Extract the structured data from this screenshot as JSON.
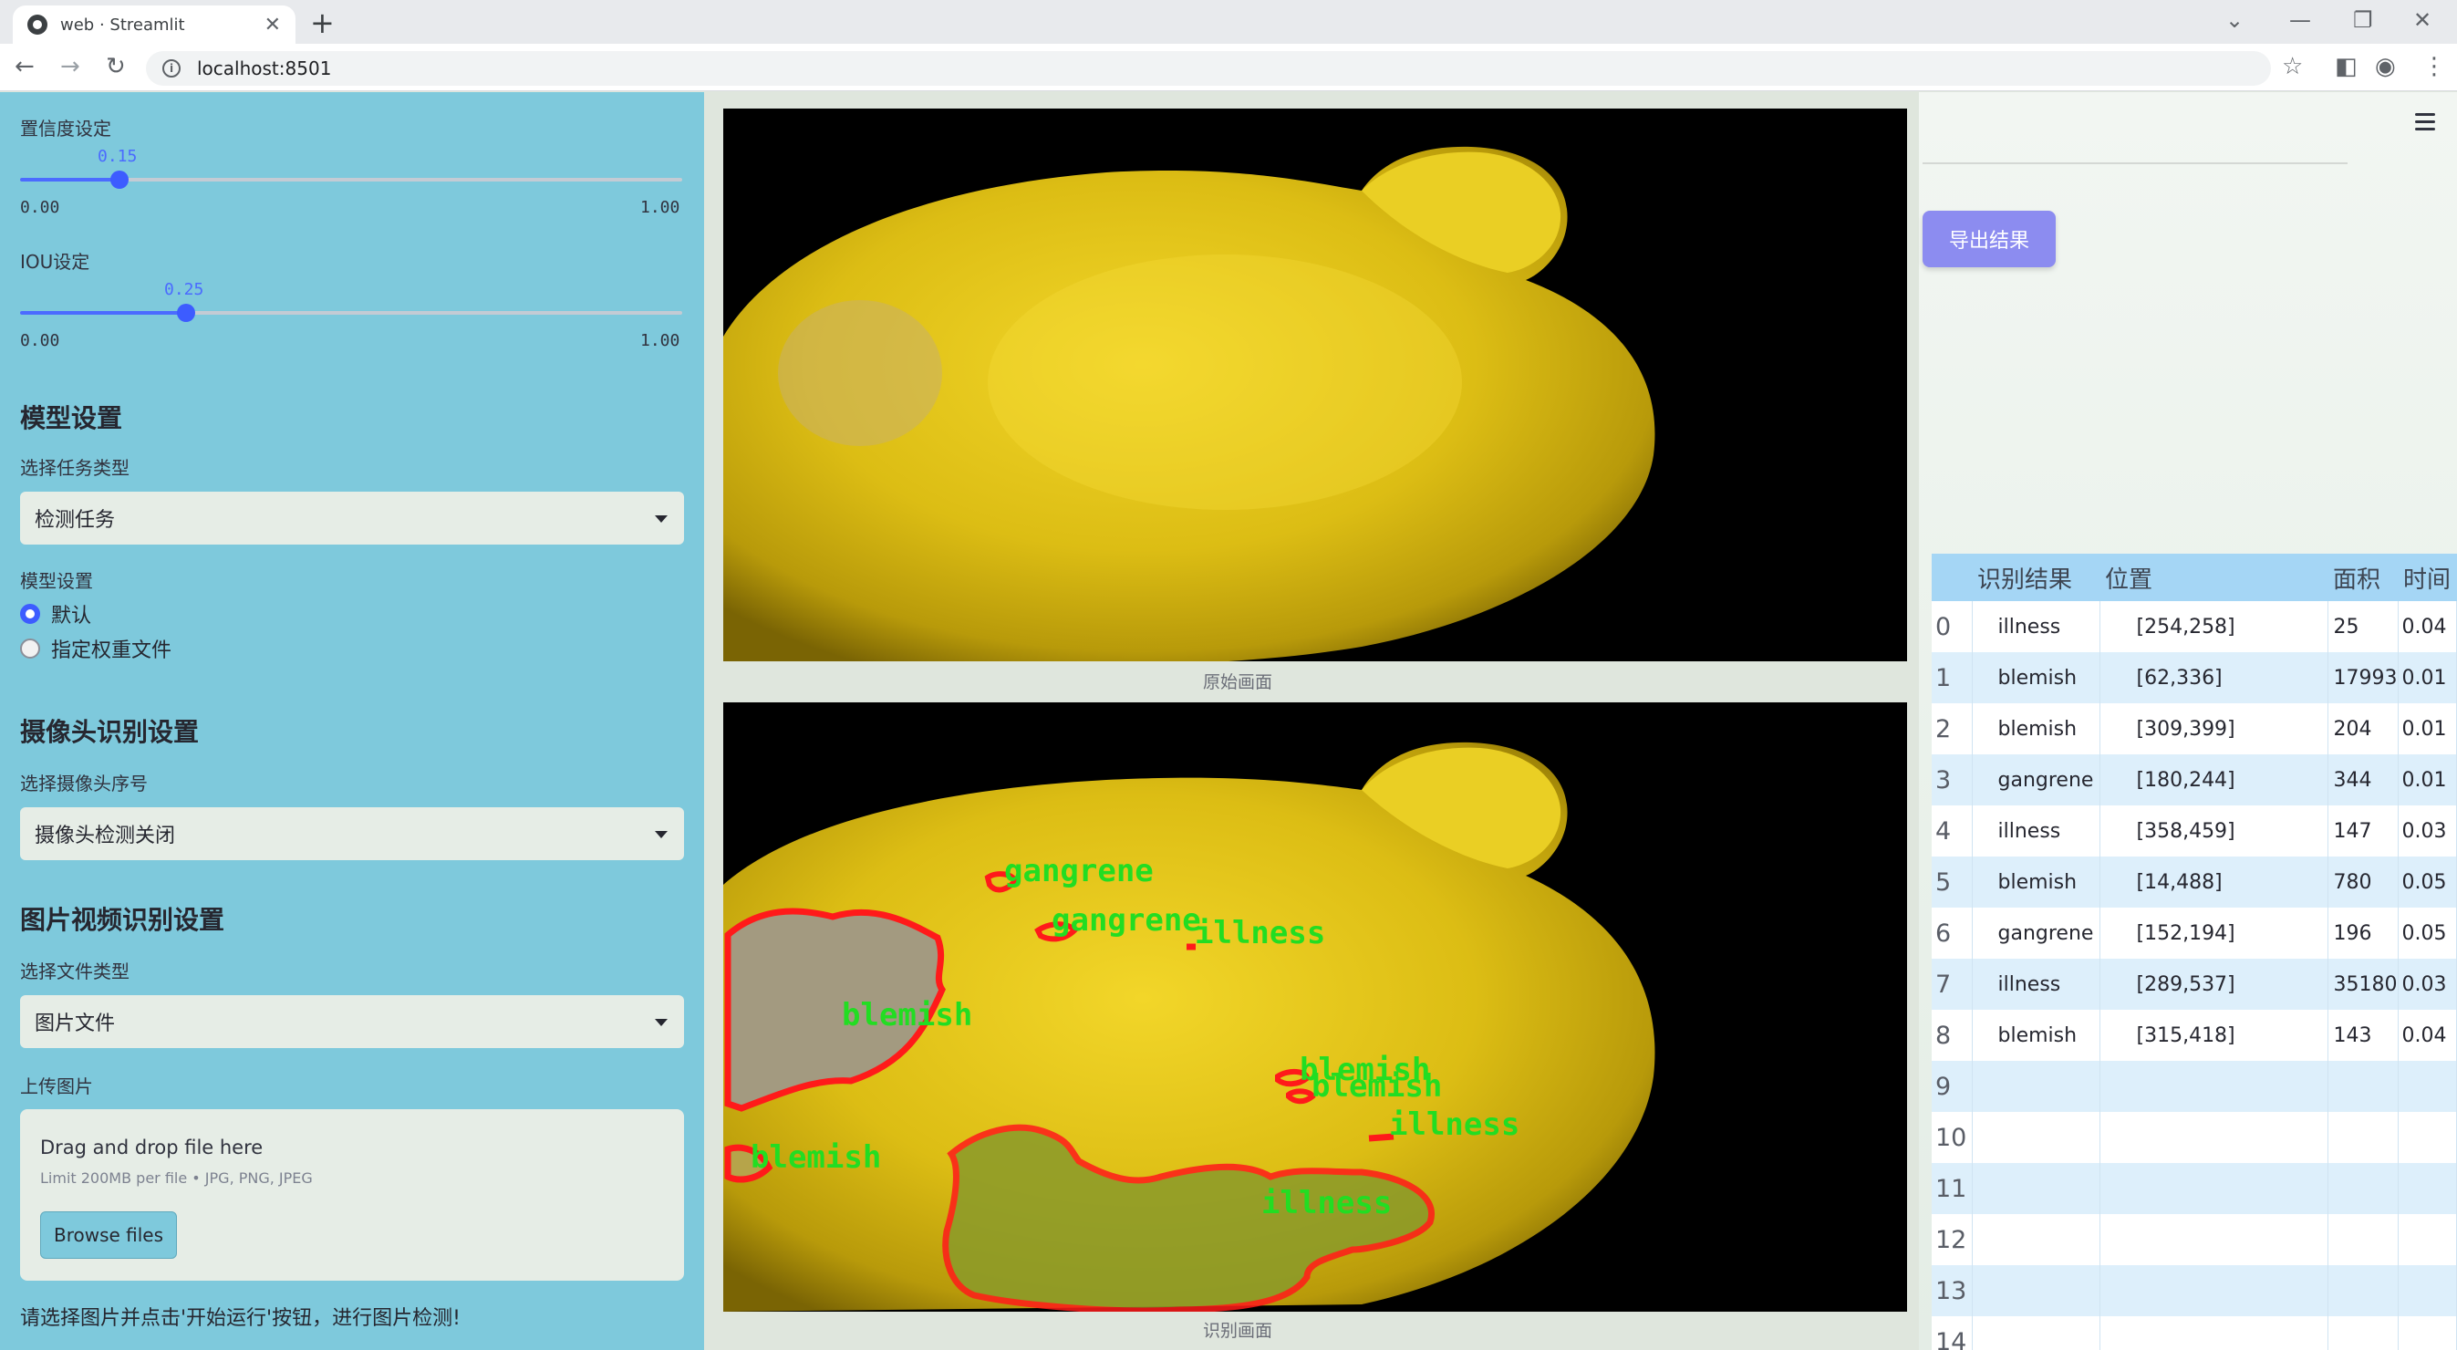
{
  "browser": {
    "tab_title": "web · Streamlit",
    "url": "localhost:8501"
  },
  "sidebar": {
    "confidence": {
      "label": "置信度设定",
      "value": "0.15",
      "min": "0.00",
      "max": "1.00",
      "fraction": 0.15
    },
    "iou": {
      "label": "IOU设定",
      "value": "0.25",
      "min": "0.00",
      "max": "1.00",
      "fraction": 0.25
    },
    "model_section": {
      "heading": "模型设置",
      "task_label": "选择任务类型",
      "task_value": "检测任务",
      "model_label": "模型设置",
      "radio_default": "默认",
      "radio_custom": "指定权重文件",
      "selected": "默认"
    },
    "camera_section": {
      "heading": "摄像头识别设置",
      "camera_label": "选择摄像头序号",
      "camera_value": "摄像头检测关闭"
    },
    "media_section": {
      "heading": "图片视频识别设置",
      "type_label": "选择文件类型",
      "type_value": "图片文件",
      "upload_label": "上传图片",
      "drop_text": "Drag and drop file here",
      "limit_text": "Limit 200MB per file • JPG, PNG, JPEG",
      "browse_label": "Browse files"
    },
    "footer_hint": "请选择图片并点击'开始运行'按钮，进行图片检测!"
  },
  "main": {
    "original_caption": "原始画面",
    "result_caption": "识别画面",
    "detections_overlay": [
      {
        "label": "gangrene"
      },
      {
        "label": "gangrene"
      },
      {
        "label": "illness"
      },
      {
        "label": "blemish"
      },
      {
        "label": "blemish"
      },
      {
        "label": "blemish"
      },
      {
        "label": "illness"
      },
      {
        "label": "blemish"
      },
      {
        "label": "illness"
      }
    ],
    "colors": {
      "box": "#ff1a1a",
      "label": "#22dd22",
      "fruit": "#e8c81a"
    }
  },
  "right_panel": {
    "export_label": "导出结果",
    "table": {
      "headers": [
        "识别结果",
        "位置",
        "面积",
        "时间"
      ],
      "rows": [
        {
          "idx": "0",
          "name": "illness",
          "pos": "[254,258]",
          "area": "25",
          "time": "0.04"
        },
        {
          "idx": "1",
          "name": "blemish",
          "pos": "[62,336]",
          "area": "17993",
          "time": "0.01"
        },
        {
          "idx": "2",
          "name": "blemish",
          "pos": "[309,399]",
          "area": "204",
          "time": "0.01"
        },
        {
          "idx": "3",
          "name": "gangrene",
          "pos": "[180,244]",
          "area": "344",
          "time": "0.01"
        },
        {
          "idx": "4",
          "name": "illness",
          "pos": "[358,459]",
          "area": "147",
          "time": "0.03"
        },
        {
          "idx": "5",
          "name": "blemish",
          "pos": "[14,488]",
          "area": "780",
          "time": "0.05"
        },
        {
          "idx": "6",
          "name": "gangrene",
          "pos": "[152,194]",
          "area": "196",
          "time": "0.05"
        },
        {
          "idx": "7",
          "name": "illness",
          "pos": "[289,537]",
          "area": "35180",
          "time": "0.03"
        },
        {
          "idx": "8",
          "name": "blemish",
          "pos": "[315,418]",
          "area": "143",
          "time": "0.04"
        },
        {
          "idx": "9",
          "name": "",
          "pos": "",
          "area": "",
          "time": ""
        },
        {
          "idx": "10",
          "name": "",
          "pos": "",
          "area": "",
          "time": ""
        },
        {
          "idx": "11",
          "name": "",
          "pos": "",
          "area": "",
          "time": ""
        },
        {
          "idx": "12",
          "name": "",
          "pos": "",
          "area": "",
          "time": ""
        },
        {
          "idx": "13",
          "name": "",
          "pos": "",
          "area": "",
          "time": ""
        },
        {
          "idx": "14",
          "name": "",
          "pos": "",
          "area": "",
          "time": ""
        }
      ]
    }
  }
}
